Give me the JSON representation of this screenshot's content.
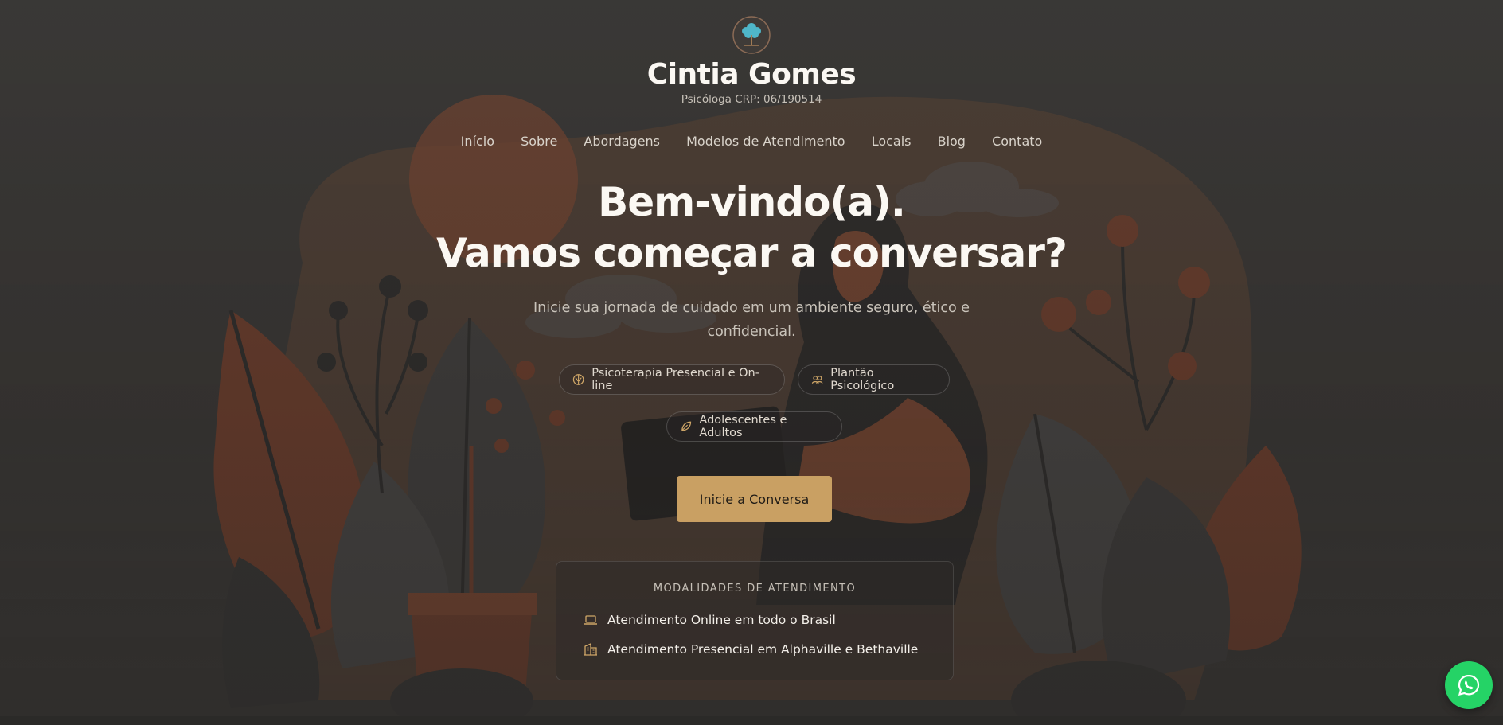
{
  "brand": {
    "name": "Cintia Gomes",
    "subtitle": "Psicóloga CRP: 06/190514",
    "logo_icon": "tree-logo-icon"
  },
  "nav": {
    "items": [
      "Início",
      "Sobre",
      "Abordagens",
      "Modelos de Atendimento",
      "Locais",
      "Blog",
      "Contato"
    ]
  },
  "hero": {
    "headline_line1": "Bem-vindo(a).",
    "headline_line2": "Vamos começar a conversar?",
    "subtitle": "Inicie sua jornada de cuidado em um ambiente seguro, ético e confidencial.",
    "chips": [
      {
        "label": "Psicoterapia Presencial e On-line",
        "icon": "brain-icon"
      },
      {
        "label": "Plantão Psicológico",
        "icon": "people-icon"
      },
      {
        "label": "Adolescentes e Adultos",
        "icon": "leaf-icon"
      }
    ],
    "cta_label": "Inicie a Conversa"
  },
  "modalities": {
    "title": "MODALIDADES DE ATENDIMENTO",
    "items": [
      {
        "label": "Atendimento Online em todo o Brasil",
        "icon": "laptop-icon"
      },
      {
        "label": "Atendimento Presencial em Alphaville e Bethaville",
        "icon": "building-icon"
      }
    ]
  },
  "floating": {
    "icon": "whatsapp-icon"
  },
  "colors": {
    "background": "#3a3836",
    "accent": "#c9a063",
    "rust": "#8a4a30",
    "whatsapp": "#25d366"
  }
}
